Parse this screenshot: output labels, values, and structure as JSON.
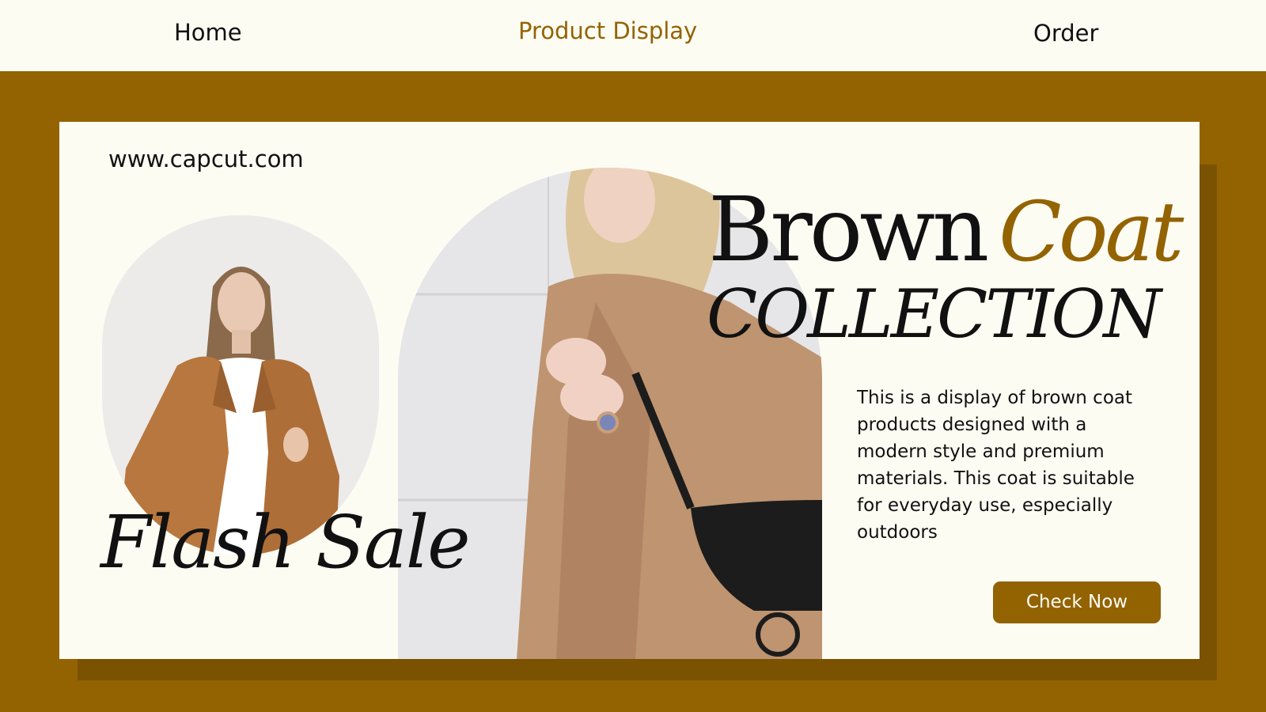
{
  "nav": {
    "home": "Home",
    "product_display": "Product Display",
    "order": "Order"
  },
  "banner": {
    "url": "www.capcut.com",
    "headline_word_1": "Brown",
    "headline_word_2": "Coat",
    "headline_line_2": "COLLECTION",
    "flash_sale": "Flash Sale",
    "description": "This is a display of brown coat\nproducts designed with a\nmodern style and premium\nmaterials. This coat is suitable\n for everyday use, especially\noutdoors",
    "cta_label": "Check Now"
  },
  "colors": {
    "accent": "#936302",
    "background": "#fdfcf3",
    "text": "#111111"
  },
  "images": {
    "small_photo": "woman-in-brown-trench-coat-photo",
    "large_photo": "woman-in-camel-coat-with-black-bag-photo"
  }
}
